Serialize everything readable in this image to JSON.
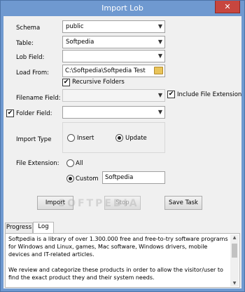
{
  "window": {
    "title": "Import Lob",
    "close_glyph": "✕"
  },
  "fields": {
    "schema": {
      "label": "Schema",
      "value": "public"
    },
    "table": {
      "label": "Table:",
      "value": "Softpedia"
    },
    "lob_field": {
      "label": "Lob Field:",
      "value": ""
    },
    "load_from": {
      "label": "Load From:",
      "value": "C:\\Softpedia\\Softpedia Test"
    },
    "recursive": {
      "label": "Recursive Folders",
      "checked": true
    },
    "filename_field": {
      "label": "Filename Field:",
      "value": ""
    },
    "include_ext": {
      "label": "Include File Extension",
      "checked": true
    },
    "folder_field": {
      "label": "Folder Field:",
      "checked": true,
      "value": ""
    },
    "import_type": {
      "label": "Import Type",
      "options": [
        "Insert",
        "Update"
      ],
      "selected": "Update"
    },
    "file_extension": {
      "label": "File Extension:",
      "options": [
        "All",
        "Custom"
      ],
      "selected": "Custom",
      "custom_value": "Softpedia"
    }
  },
  "buttons": {
    "import": "Import",
    "stop": "Stop",
    "save_task": "Save Task"
  },
  "tabs": [
    "Progress",
    "Log"
  ],
  "active_tab": "Log",
  "log": {
    "text": "Softpedia is a library of over 1.300.000 free and free-to-try software programs for Windows and Linux, games, Mac software, Windows drivers, mobile devices and IT-related articles.\n\nWe review and categorize these products in order to allow the visitor/user to find the exact product they and their system needs."
  },
  "watermark": "SOFTPEDIA",
  "glyphs": {
    "check": "✔",
    "dropdown": "▼",
    "scroll_up": "▲",
    "scroll_down": "▼"
  }
}
